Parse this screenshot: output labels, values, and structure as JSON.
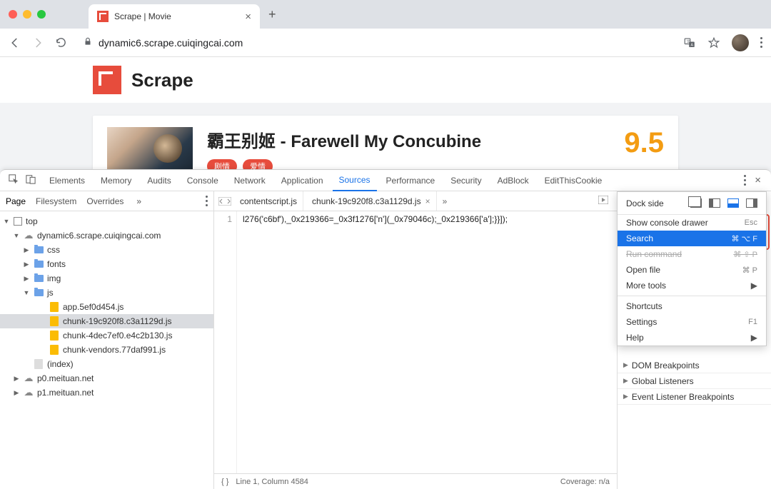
{
  "browser": {
    "tab_title": "Scrape | Movie",
    "url": "dynamic6.scrape.cuiqingcai.com"
  },
  "page": {
    "brand": "Scrape",
    "movie_title": "霸王别姬 - Farewell My Concubine",
    "rating": "9.5",
    "tags": [
      "剧情",
      "爱情"
    ]
  },
  "devtools": {
    "tabs": [
      "Elements",
      "Memory",
      "Audits",
      "Console",
      "Network",
      "Application",
      "Sources",
      "Performance",
      "Security",
      "AdBlock",
      "EditThisCookie"
    ],
    "active_tab": "Sources",
    "sources_nav_tabs": [
      "Page",
      "Filesystem",
      "Overrides"
    ],
    "active_nav_tab": "Page",
    "file_tree": {
      "top": "top",
      "domain": "dynamic6.scrape.cuiqingcai.com",
      "folders": [
        "css",
        "fonts",
        "img",
        "js"
      ],
      "js_files": [
        "app.5ef0d454.js",
        "chunk-19c920f8.c3a1129d.js",
        "chunk-4dec7ef0.e4c2b130.js",
        "chunk-vendors.77daf991.js"
      ],
      "index": "(index)",
      "other_domains": [
        "p0.meituan.net",
        "p1.meituan.net"
      ]
    },
    "editor": {
      "open_files": [
        "contentscript.js",
        "chunk-19c920f8.c3a1129d.js"
      ],
      "active_file": "chunk-19c920f8.c3a1129d.js",
      "line_no": "1",
      "code": "l276('c6bf'),_0x219366=_0x3f1276['n'](_0x79046c);_0x219366['a'];}}]);",
      "status_left": "Line 1, Column 4584",
      "status_right": "Coverage: n/a"
    },
    "right_panels": [
      "DOM Breakpoints",
      "Global Listeners",
      "Event Listener Breakpoints"
    ],
    "menu": {
      "dockside_label": "Dock side",
      "items": [
        {
          "label": "Show console drawer",
          "shortcut": "Esc"
        },
        {
          "label": "Search",
          "shortcut": "⌘ ⌥ F",
          "highlight": true
        },
        {
          "label": "Run command",
          "shortcut": "⌘ ⇧ P",
          "struck": true
        },
        {
          "label": "Open file",
          "shortcut": "⌘ P"
        },
        {
          "label": "More tools",
          "arrow": true
        },
        {
          "sep": true
        },
        {
          "label": "Shortcuts"
        },
        {
          "label": "Settings",
          "shortcut": "F1"
        },
        {
          "label": "Help",
          "arrow": true
        }
      ]
    }
  }
}
